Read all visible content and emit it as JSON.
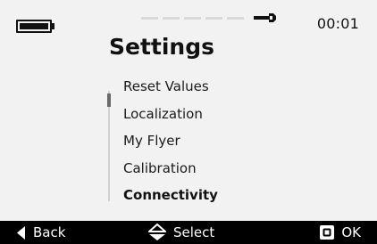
{
  "status_bar": {
    "clock": "00:01",
    "battery_icon": "battery-full-icon",
    "settings_icon": "wrench-icon"
  },
  "header": {
    "title": "Settings"
  },
  "menu": {
    "items": [
      {
        "label": "Reset Values",
        "selected": false
      },
      {
        "label": "Localization",
        "selected": false
      },
      {
        "label": "My Flyer",
        "selected": false
      },
      {
        "label": "Calibration",
        "selected": false
      },
      {
        "label": "Connectivity",
        "selected": true
      }
    ]
  },
  "softkeys": {
    "back": {
      "label": "Back",
      "icon": "triangle-left-icon"
    },
    "select": {
      "label": "Select",
      "icon": "up-down-arrows-icon"
    },
    "ok": {
      "label": "OK",
      "icon": "square-button-icon"
    }
  },
  "colors": {
    "background": "#f2f2f2",
    "text": "#111111",
    "bottom_bar": "#000000",
    "bottom_bar_text": "#ffffff"
  }
}
